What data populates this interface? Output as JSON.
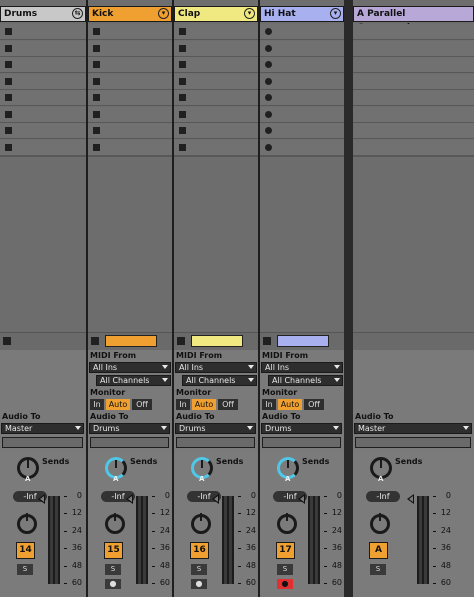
{
  "tracks": [
    {
      "id": "drums",
      "name": "Drums",
      "color": "#c8c8c8",
      "header_icon": "group-fold-icon",
      "slots": 8,
      "slot_type": "stop",
      "swatch": null,
      "midi": false,
      "audio_to": "Master",
      "number": "14",
      "solo": "S",
      "arm": null,
      "knob": "gray"
    },
    {
      "id": "kick",
      "name": "Kick",
      "color": "#f0a030",
      "header_icon": "fold-down-icon",
      "slots": 8,
      "slot_type": "stop",
      "swatch": "#f0a030",
      "midi": true,
      "audio_to": "Drums",
      "number": "15",
      "solo": "S",
      "arm": "off",
      "knob": "blue"
    },
    {
      "id": "clap",
      "name": "Clap",
      "color": "#f0e880",
      "header_icon": "fold-down-icon",
      "slots": 8,
      "slot_type": "stop",
      "swatch": "#f0e880",
      "midi": true,
      "audio_to": "Drums",
      "number": "16",
      "solo": "S",
      "arm": "off",
      "knob": "blue"
    },
    {
      "id": "hihat",
      "name": "Hi Hat",
      "color": "#a8b0f0",
      "header_icon": "fold-down-icon",
      "slots": 8,
      "slot_type": "record",
      "swatch": "#a8b0f0",
      "midi": true,
      "audio_to": "Drums",
      "number": "17",
      "solo": "S",
      "arm": "on",
      "knob": "blue"
    },
    {
      "id": "return-a",
      "name": "A Parallel Compression",
      "color": "#b8a8d8",
      "header_icon": null,
      "slots": 8,
      "slot_type": "none",
      "swatch": null,
      "midi": false,
      "audio_to": "Master",
      "number": "A",
      "solo": "S",
      "arm": null,
      "knob": "gray"
    }
  ],
  "labels": {
    "midi_from": "MIDI From",
    "all_ins": "All Ins",
    "all_channels": "All Channels",
    "monitor": "Monitor",
    "mon_in": "In",
    "mon_auto": "Auto",
    "mon_off": "Off",
    "audio_to": "Audio To",
    "sends": "Sends",
    "send_letter": "A",
    "volume": "-Inf",
    "arm_glyph": "●"
  },
  "meter_scale": [
    "0",
    "12",
    "24",
    "36",
    "48",
    "60"
  ],
  "accent": "#f0a030"
}
